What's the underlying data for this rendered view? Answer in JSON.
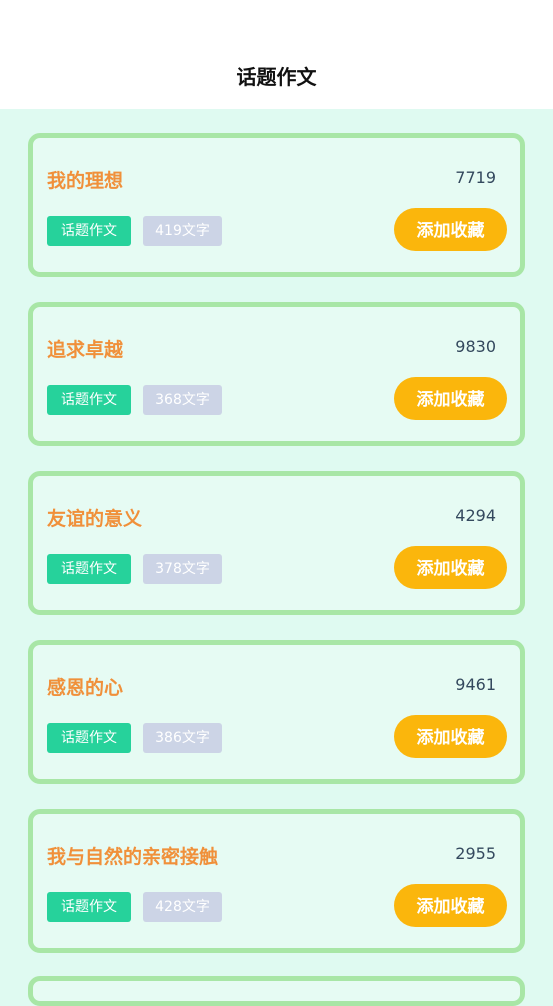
{
  "header": {
    "title": "话题作文"
  },
  "colors": {
    "page_bg": "#dffaf1",
    "card_border": "#a8e6a6",
    "title_orange": "#f0903a",
    "tag_green": "#26d29b",
    "tag_gray": "#ccd4e6",
    "button_yellow": "#fbb60c"
  },
  "cards": [
    {
      "title": "我的理想",
      "count": "7719",
      "tag": "话题作文",
      "words": "419文字",
      "button": "添加收藏"
    },
    {
      "title": "追求卓越",
      "count": "9830",
      "tag": "话题作文",
      "words": "368文字",
      "button": "添加收藏"
    },
    {
      "title": "友谊的意义",
      "count": "4294",
      "tag": "话题作文",
      "words": "378文字",
      "button": "添加收藏"
    },
    {
      "title": "感恩的心",
      "count": "9461",
      "tag": "话题作文",
      "words": "386文字",
      "button": "添加收藏"
    },
    {
      "title": "我与自然的亲密接触",
      "count": "2955",
      "tag": "话题作文",
      "words": "428文字",
      "button": "添加收藏"
    }
  ]
}
